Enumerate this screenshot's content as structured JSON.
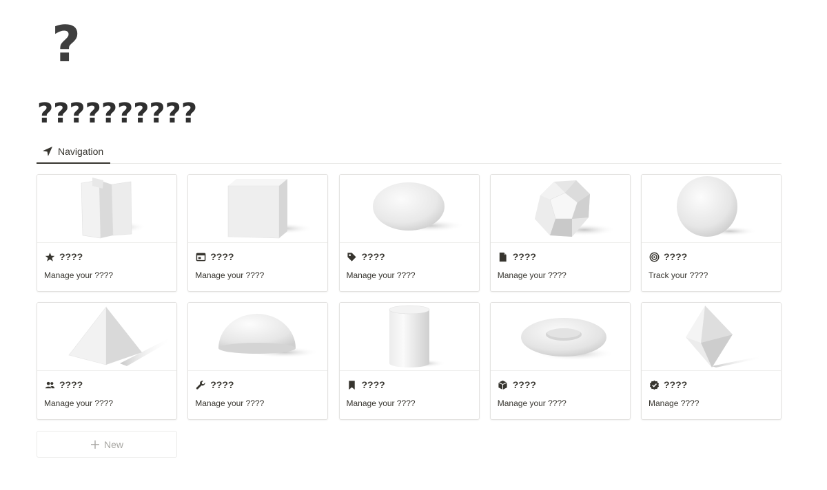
{
  "page": {
    "icon": "?",
    "title": "??????????"
  },
  "tabs": [
    {
      "label": "Navigation",
      "icon": "navigation-arrow-icon"
    }
  ],
  "cards": [
    {
      "title": "????",
      "description": "Manage your ????",
      "icon": "star-icon",
      "cover": "folded-prism-shape"
    },
    {
      "title": "????",
      "description": "Manage your ????",
      "icon": "browser-window-icon",
      "cover": "cube-shape"
    },
    {
      "title": "????",
      "description": "Manage your ????",
      "icon": "tag-icon",
      "cover": "ellipsoid-shape"
    },
    {
      "title": "????",
      "description": "Manage your ????",
      "icon": "document-icon",
      "cover": "dodecahedron-shape"
    },
    {
      "title": "????",
      "description": "Track your ????",
      "icon": "target-icon",
      "cover": "sphere-shape"
    },
    {
      "title": "????",
      "description": "Manage your ????",
      "icon": "people-icon",
      "cover": "pyramid-shape"
    },
    {
      "title": "????",
      "description": "Manage your ????",
      "icon": "wrench-icon",
      "cover": "hemisphere-shape"
    },
    {
      "title": "????",
      "description": "Manage your ????",
      "icon": "bookmark-icon",
      "cover": "cylinder-shape"
    },
    {
      "title": "????",
      "description": "Manage your ????",
      "icon": "package-icon",
      "cover": "torus-shape"
    },
    {
      "title": "????",
      "description": "Manage ????",
      "icon": "verified-check-icon",
      "cover": "octahedron-shape"
    }
  ],
  "new_button": {
    "label": "New",
    "icon": "plus-icon"
  },
  "colors": {
    "text": "#37352f",
    "border": "#e3e2e0",
    "muted": "#a7a6a2"
  }
}
